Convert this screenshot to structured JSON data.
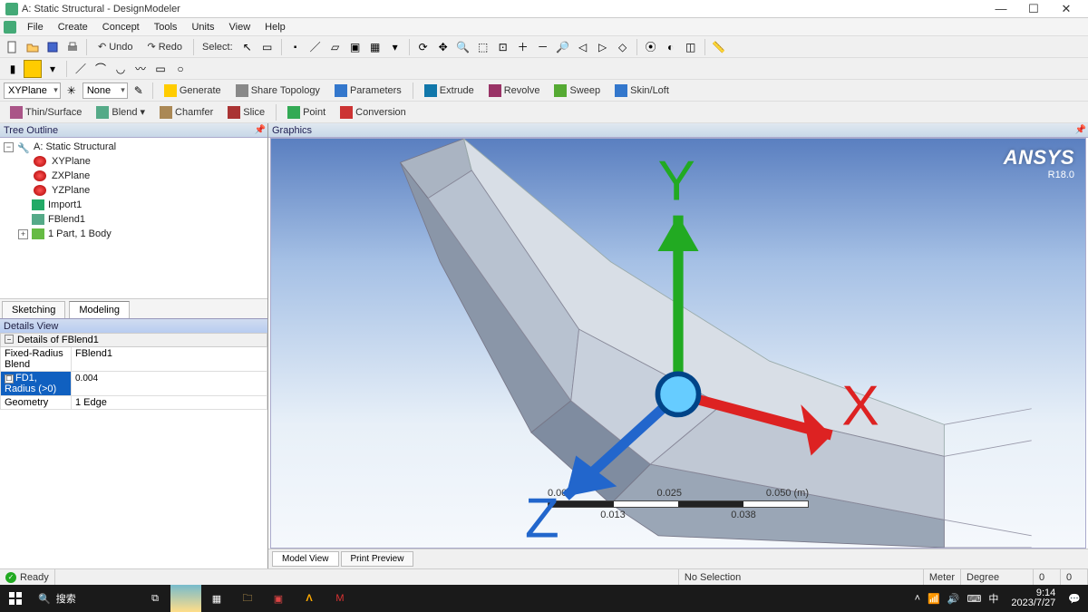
{
  "window": {
    "title": "A: Static Structural - DesignModeler"
  },
  "menu": {
    "items": [
      "File",
      "Create",
      "Concept",
      "Tools",
      "Units",
      "View",
      "Help"
    ]
  },
  "toolbar2": {
    "undo": "Undo",
    "redo": "Redo",
    "select": "Select:"
  },
  "combo": {
    "plane": "XYPlane",
    "sketch": "None"
  },
  "cmds1": {
    "generate": "Generate",
    "share": "Share Topology",
    "param": "Parameters",
    "extrude": "Extrude",
    "revolve": "Revolve",
    "sweep": "Sweep",
    "skin": "Skin/Loft"
  },
  "cmds2": {
    "thin": "Thin/Surface",
    "blend": "Blend",
    "chamfer": "Chamfer",
    "slice": "Slice",
    "point": "Point",
    "conv": "Conversion"
  },
  "panels": {
    "tree": "Tree Outline",
    "graphics": "Graphics",
    "details": "Details View"
  },
  "tree": {
    "root": "A: Static Structural",
    "items": [
      "XYPlane",
      "ZXPlane",
      "YZPlane",
      "Import1",
      "FBlend1",
      "1 Part, 1 Body"
    ]
  },
  "tree_tabs": {
    "sketching": "Sketching",
    "modeling": "Modeling"
  },
  "details": {
    "title": "Details of FBlend1",
    "rows": [
      {
        "k": "Fixed-Radius Blend",
        "v": "FBlend1"
      },
      {
        "k": "FD1, Radius (>0)",
        "v": "0.004"
      },
      {
        "k": "Geometry",
        "v": "1 Edge"
      }
    ]
  },
  "ansys": {
    "brand": "ANSYS",
    "version": "R18.0"
  },
  "ruler": {
    "t0": "0.000",
    "t1": "0.025",
    "t2": "0.050 (m)",
    "s0": "0.013",
    "s1": "0.038"
  },
  "btabs": {
    "model": "Model View",
    "print": "Print Preview"
  },
  "status": {
    "ready": "Ready",
    "sel": "No Selection",
    "unit1": "Meter",
    "unit2": "Degree",
    "c1": "0",
    "c2": "0"
  },
  "taskbar": {
    "search": "搜索",
    "time": "9:14",
    "date": "2023/7/27",
    "ime": "中"
  },
  "triad": {
    "x": "X",
    "y": "Y",
    "z": "Z"
  }
}
